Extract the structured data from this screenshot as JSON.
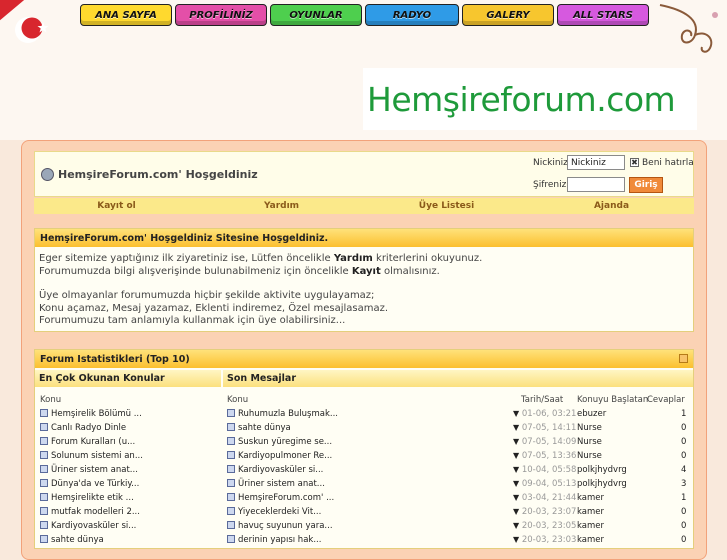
{
  "nav": [
    {
      "label": "ANA SAYFA",
      "color": "#ffd92e"
    },
    {
      "label": "PROFİLİNİZ",
      "color": "#e44fa8"
    },
    {
      "label": "OYUNLAR",
      "color": "#4ecf4e"
    },
    {
      "label": "RADYO",
      "color": "#2f9be7"
    },
    {
      "label": "GALERY",
      "color": "#f7c62e"
    },
    {
      "label": "ALL STARS",
      "color": "#d659df"
    }
  ],
  "logo": "Hemşireforum.com",
  "welcome": {
    "title": "HemşireForum.com' Hoşgeldiniz",
    "nick_label": "Nickiniz",
    "nick_value": "Nickiniz",
    "remember": "Beni hatırla",
    "pass_label": "Şifreniz",
    "login": "Giriş"
  },
  "links": [
    "Kayıt ol",
    "Yardım",
    "Üye Listesi",
    "Ajanda"
  ],
  "notice": {
    "title": "HemşireForum.com' Hoşgeldiniz Sitesine Hoşgeldiniz.",
    "l1a": "Eger sitemize yaptığınız ilk ziyaretiniz ise, Lütfen öncelikle ",
    "l1b": "Yardım",
    "l1c": " kriterlerini okuyunuz.",
    "l2a": "Forumumuzda bilgi alışverişinde bulunabilmeniz için öncelikle ",
    "l2b": "Kayıt",
    "l2c": " olmalısınız.",
    "l3": "Üye olmayanlar forumumuzda hiçbir şekilde aktivite uygulayamaz;",
    "l4": "Konu açamaz, Mesaj yazamaz, Eklenti indiremez, Özel mesajlasamaz.",
    "l5": "Forumumuzu tam anlamıyla kullanmak için üye olabilirsiniz..."
  },
  "stats": {
    "title": "Forum Istatistikleri (Top 10)",
    "left_title": "En Çok Okunan Konular",
    "right_title": "Son Mesajlar",
    "left_col": "Konu",
    "right_col": "Konu",
    "date_col": "Tarih/Saat",
    "starter_col": "Konuyu Başlatan",
    "replies_col": "Cevaplar",
    "popular": [
      "Hemşirelik Bölümü ...",
      "Canlı Radyo Dinle",
      "Forum Kuralları (u...",
      "Solunum sistemi an...",
      "Üriner sistem anat...",
      "Dünya'da ve Türkiy...",
      "Hemşirelikte etik ...",
      "mutfak modelleri 2...",
      "Kardiyovasküler si...",
      "sahte dünya"
    ],
    "latest": [
      {
        "topic": "Ruhumuzla Buluşmak...",
        "date": "01-06, 03:21",
        "user": "ebuzer",
        "replies": "1"
      },
      {
        "topic": "sahte dünya",
        "date": "07-05, 14:11",
        "user": "Nurse",
        "replies": "0"
      },
      {
        "topic": "Suskun yüregime se...",
        "date": "07-05, 14:09",
        "user": "Nurse",
        "replies": "0"
      },
      {
        "topic": "Kardiyopulmoner Re...",
        "date": "07-05, 13:36",
        "user": "Nurse",
        "replies": "0"
      },
      {
        "topic": "Kardiyovasküler si...",
        "date": "10-04, 05:58",
        "user": "polkjhydvrg",
        "replies": "4"
      },
      {
        "topic": "Üriner sistem anat...",
        "date": "09-04, 05:13",
        "user": "polkjhydvrg",
        "replies": "3"
      },
      {
        "topic": "HemşireForum.com' ...",
        "date": "03-04, 21:44",
        "user": "kamer",
        "replies": "1"
      },
      {
        "topic": "Yiyeceklerdeki Vit...",
        "date": "20-03, 23:07",
        "user": "kamer",
        "replies": "0"
      },
      {
        "topic": "havuç suyunun yara...",
        "date": "20-03, 23:05",
        "user": "kamer",
        "replies": "0"
      },
      {
        "topic": "derinin yapısı hak...",
        "date": "20-03, 23:03",
        "user": "kamer",
        "replies": "0"
      }
    ]
  },
  "colors": {
    "accent": "#fbbf2f",
    "logo": "#1e9a3a",
    "flag": "#d8262e"
  }
}
